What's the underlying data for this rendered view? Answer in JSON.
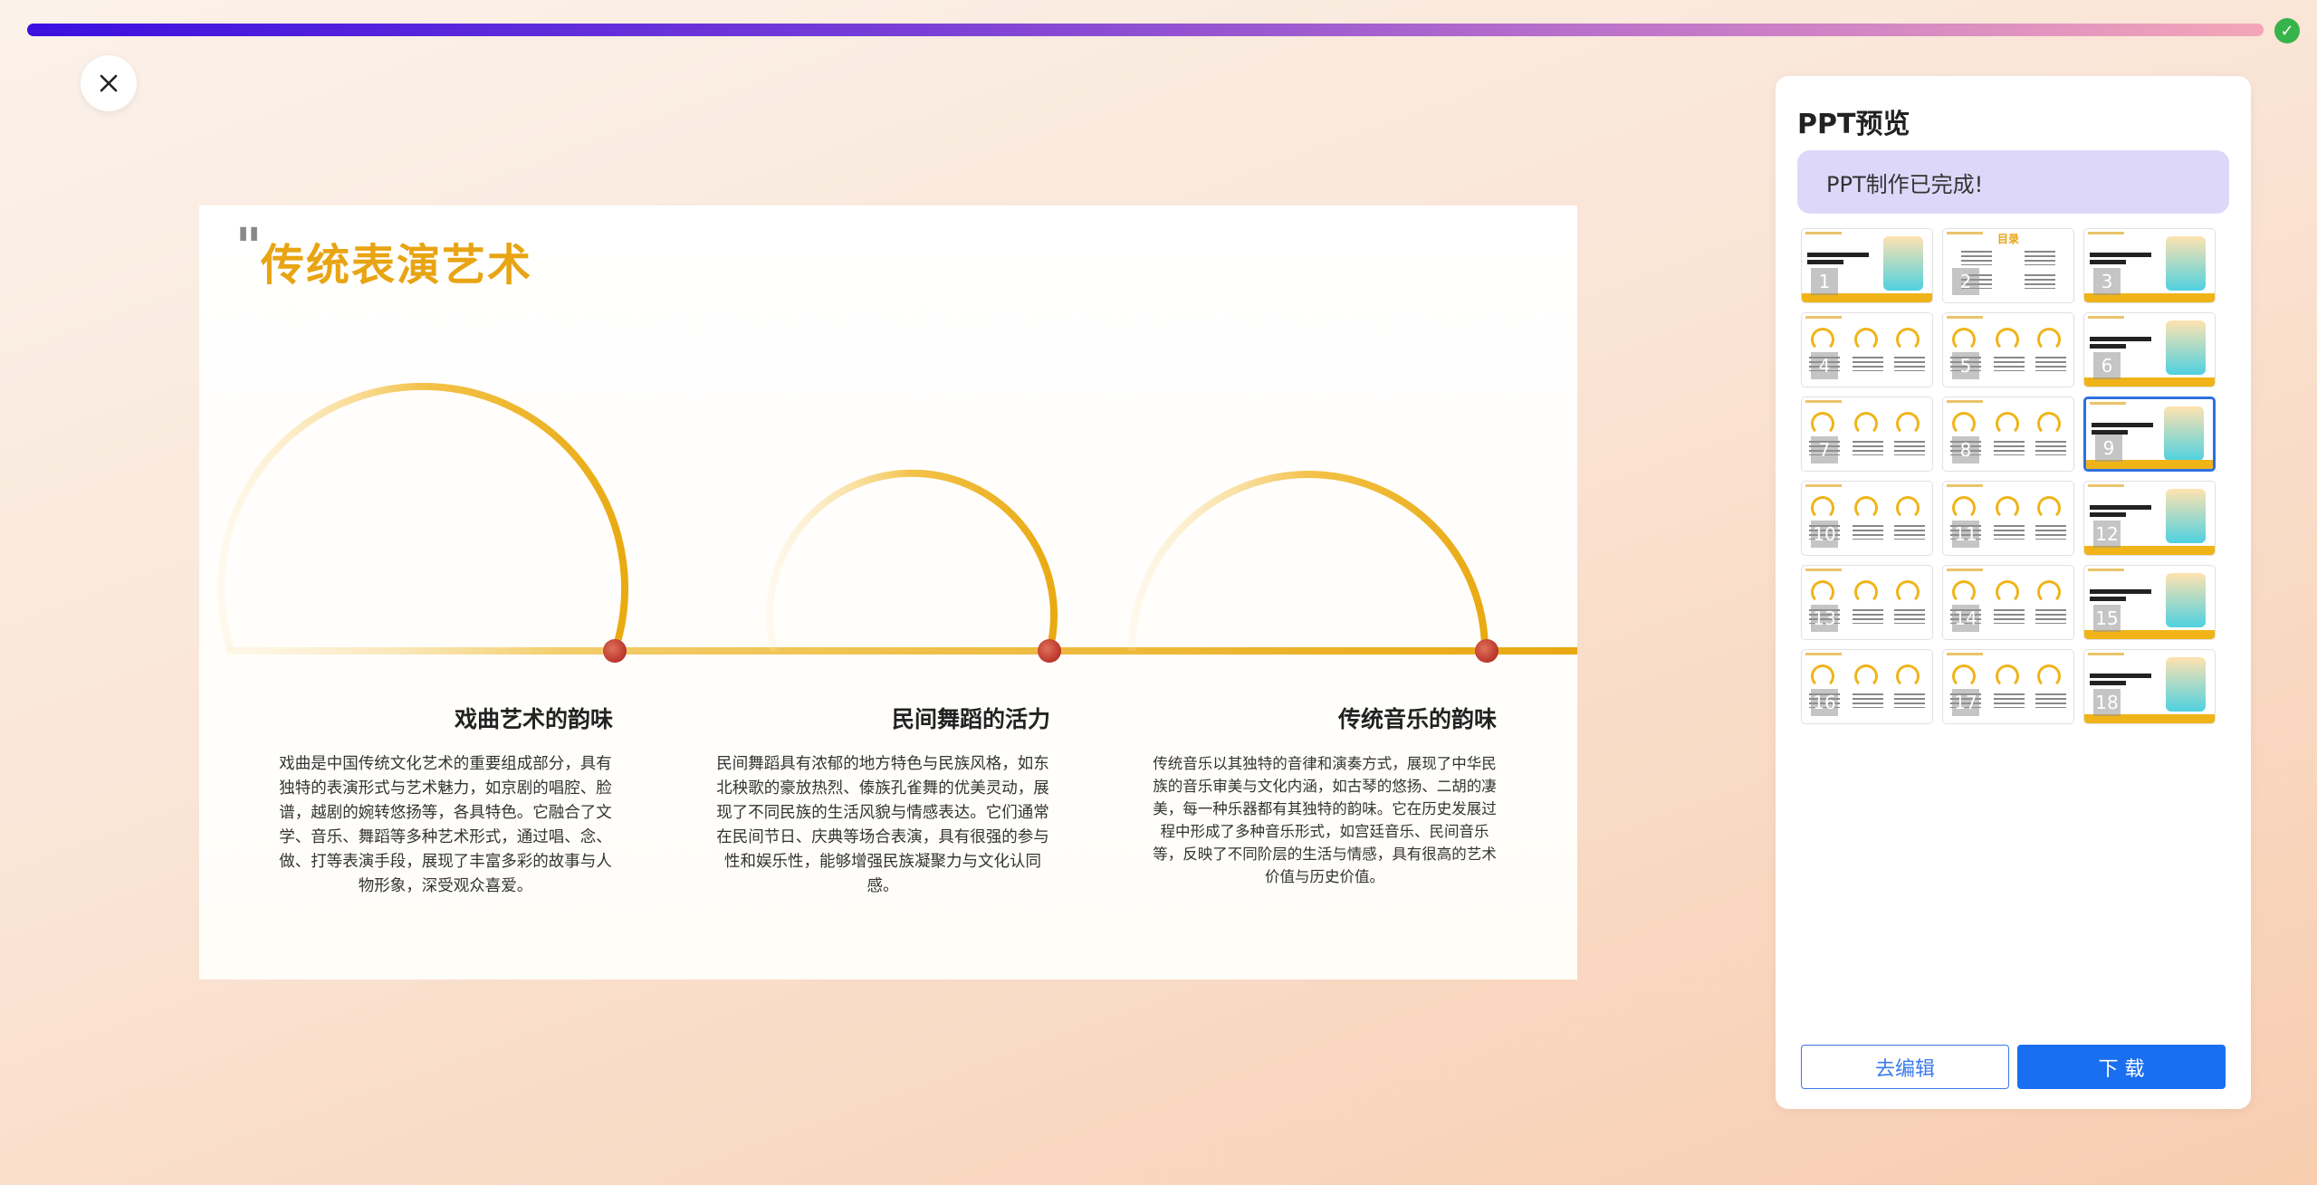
{
  "progress": {
    "percent": 100,
    "status": "complete"
  },
  "slide": {
    "title": "传统表演艺术",
    "columns": [
      {
        "heading": "戏曲艺术的韵味",
        "body": "戏曲是中国传统文化艺术的重要组成部分，具有独特的表演形式与艺术魅力，如京剧的唱腔、脸谱，越剧的婉转悠扬等，各具特色。它融合了文学、音乐、舞蹈等多种艺术形式，通过唱、念、做、打等表演手段，展现了丰富多彩的故事与人物形象，深受观众喜爱。"
      },
      {
        "heading": "民间舞蹈的活力",
        "body": "民间舞蹈具有浓郁的地方特色与民族风格，如东北秧歌的豪放热烈、傣族孔雀舞的优美灵动，展现了不同民族的生活风貌与情感表达。它们通常在民间节日、庆典等场合表演，具有很强的参与性和娱乐性，能够增强民族凝聚力与文化认同感。"
      },
      {
        "heading": "传统音乐的韵味",
        "body": "传统音乐以其独特的音律和演奏方式，展现了中华民族的音乐审美与文化内涵，如古琴的悠扬、二胡的凄美，每一种乐器都有其独特的韵味。它在历史发展过程中形成了多种音乐形式，如宫廷音乐、民间音乐等，反映了不同阶层的生活与情感，具有很高的艺术价值与历史价值。"
      }
    ]
  },
  "panel": {
    "title": "PPT预览",
    "status": "PPT制作已完成!",
    "edit_label": "去编辑",
    "download_label": "下 载",
    "thumbnails": [
      "1",
      "2",
      "3",
      "4",
      "5",
      "6",
      "7",
      "8",
      "9",
      "10",
      "11",
      "12",
      "13",
      "14",
      "15",
      "16",
      "17",
      "18"
    ],
    "active_index": 8,
    "toc_label": "目录"
  },
  "colors": {
    "accent": "#e8a412",
    "primary_button": "#1a6ff0",
    "status_bg": "#ddd8f9",
    "check": "#36b34a"
  },
  "icons": {
    "close": "close-icon",
    "check": "check-icon"
  }
}
